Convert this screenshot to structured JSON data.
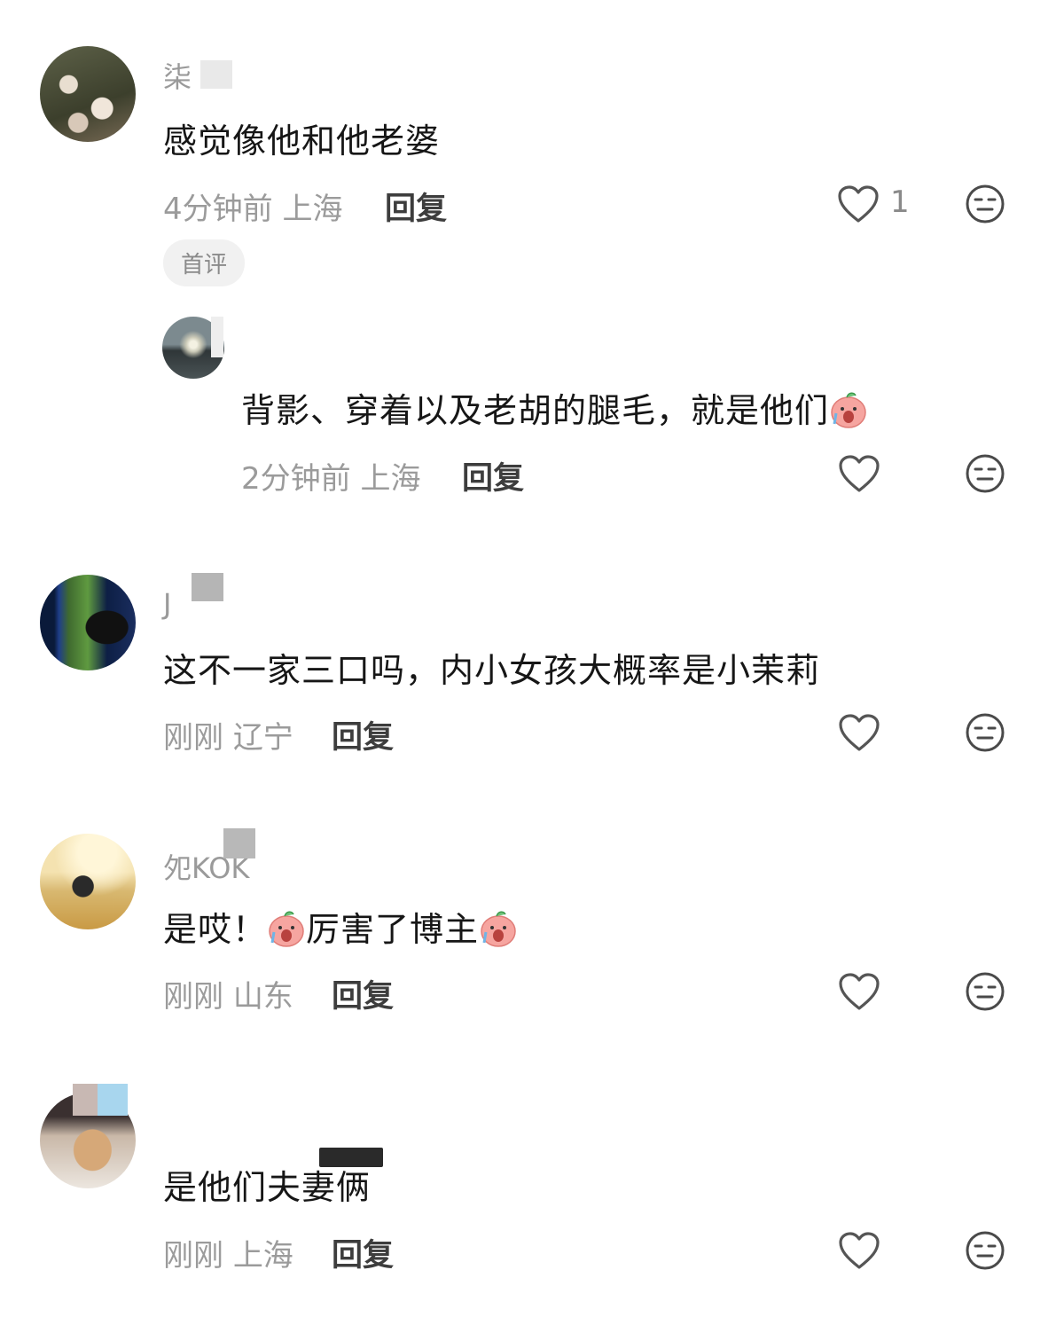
{
  "comments": [
    {
      "username": "柒",
      "text": "感觉像他和他老婆",
      "time": "4分钟前",
      "location": "上海",
      "reply_label": "回复",
      "like_count": "1",
      "badge": "首评",
      "replies": [
        {
          "username": "",
          "text": "背影、穿着以及老胡的腿毛，就是他们",
          "time": "2分钟前",
          "location": "上海",
          "reply_label": "回复"
        }
      ]
    },
    {
      "username": "J",
      "text": "这不一家三口吗，内小女孩大概率是小茉莉",
      "time": "刚刚",
      "location": "辽宁",
      "reply_label": "回复"
    },
    {
      "username": "夗KOK",
      "text_parts": [
        "是哎！",
        "厉害了博主"
      ],
      "time": "刚刚",
      "location": "山东",
      "reply_label": "回复"
    },
    {
      "username": "",
      "text": "是他们夫妻俩",
      "time": "刚刚",
      "location": "上海",
      "reply_label": "回复"
    }
  ],
  "icons": {
    "like": "heart-outline-icon",
    "dislike": "neutral-face-icon",
    "emoji": "crying-peach-emoji"
  },
  "colors": {
    "text": "#161616",
    "meta": "#9b9b9b",
    "icon": "#4a4a4a"
  }
}
